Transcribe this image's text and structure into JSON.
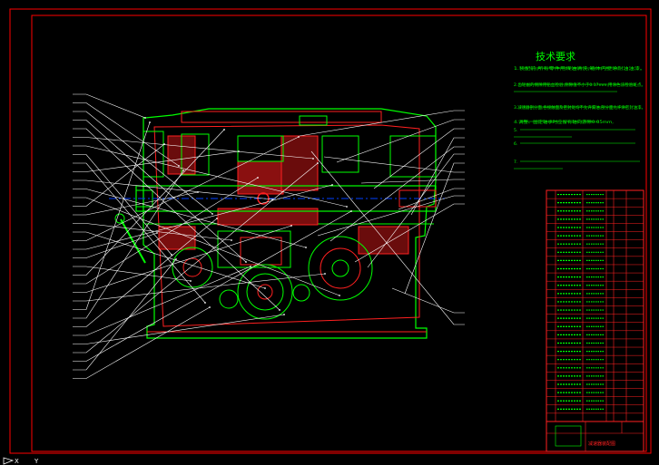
{
  "colors": {
    "background": "#000000",
    "border": "#ff0000",
    "outline": "#00ff00",
    "section": "#ff2020",
    "hatch": "#c02020",
    "leader": "#ffffff",
    "centerline": "#0040ff",
    "text": "#00ff00",
    "text_alt": "#ffffff"
  },
  "notes": {
    "title": "技术要求",
    "items": [
      "1.装配前,所有零件用煤油清洗,箱体内壁涂耐油油漆。",
      "2.齿轮副的侧隙用铅丝检验,侧隙值不小于0.17mm,用涂色法检验斑点。",
      "3.减速器剖分面,各接触面及密封处均不允许漏油,剖分面允许涂密封油漆。",
      "4.调整、固定轴承时应留有轴向游隙0.05mm,",
      "5.",
      "6.",
      "7."
    ]
  },
  "parts_list": {
    "row_count": 28
  },
  "title_block": {
    "name": "减速器装配图"
  },
  "ucs": {
    "x_label": "X",
    "y_label": "Y"
  }
}
